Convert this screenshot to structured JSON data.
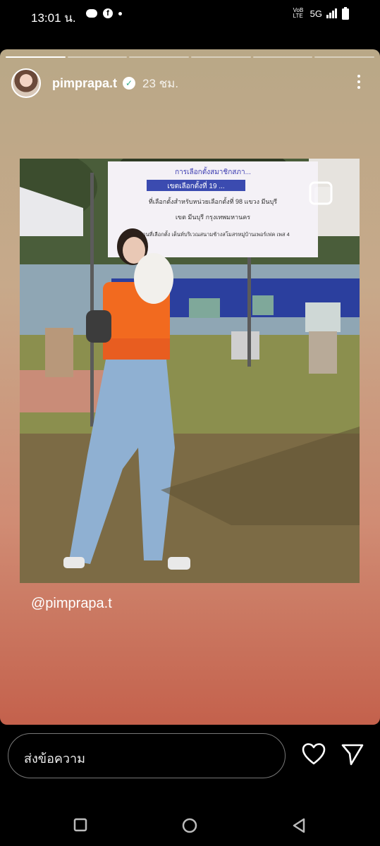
{
  "status_bar": {
    "time": "13:01 น.",
    "network": "5G",
    "volte": "VoB LTE",
    "icons": [
      "line-icon",
      "facebook-icon",
      "dot-icon",
      "signal-icon",
      "battery-icon"
    ]
  },
  "story": {
    "username": "pimprapa.t",
    "time_ago": "23 ชม.",
    "segments_total": 6,
    "segments_done": 1,
    "mention": "@pimprapa.t",
    "banner_lines": [
      "การเลือกตั้งสมาชิกสภา...",
      "เขตเลือกตั้งที่ 19 ...",
      "ที่เลือกตั้งสำหรับหน่วยเลือกตั้งที่ 98 แขวง มีนบุรี",
      "เขต มีนบุรี กรุงเทพมหานคร",
      "สถานที่เลือกตั้ง เต็นท์บริเวณสนามช้างสโมสรหมู่บ้านเพอร์เฟค เพส 4"
    ],
    "gradient_colors": [
      "#b9a887",
      "#c7a98a",
      "#d08c74",
      "#c4614c"
    ]
  },
  "reply_bar": {
    "placeholder": "ส่งข้อความ"
  }
}
